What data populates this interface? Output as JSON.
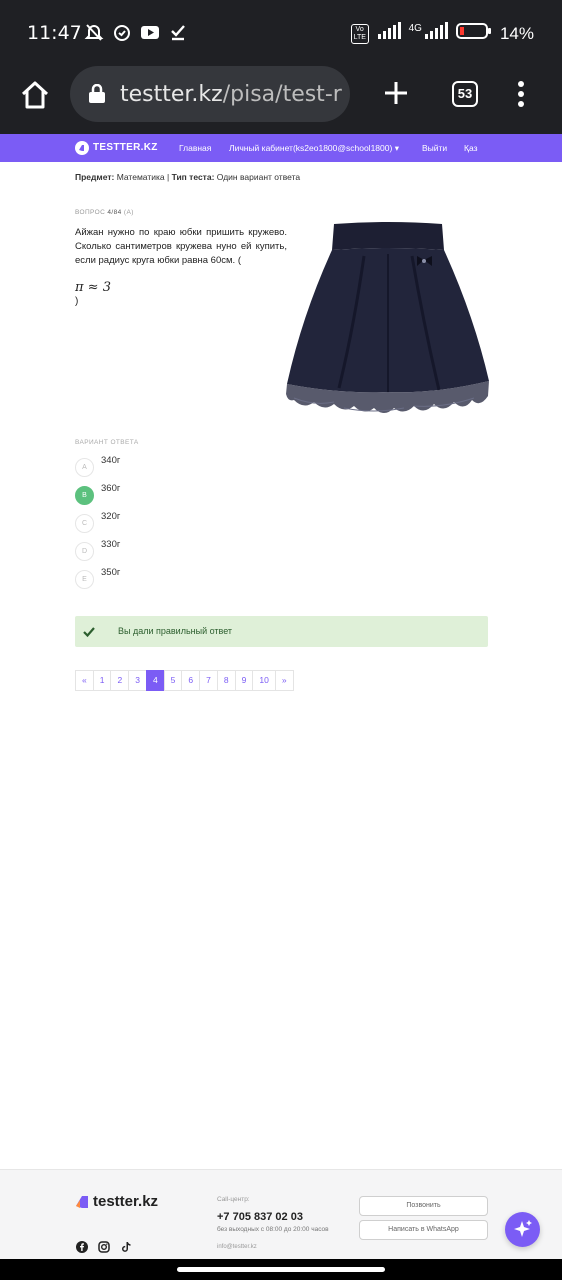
{
  "status_bar": {
    "time": "11:47",
    "network": "4G",
    "volte": "Vo LTE",
    "battery": "14%"
  },
  "browser": {
    "url_domain": "testter.kz",
    "url_path": "/pisa/test-re",
    "tab_count": "53"
  },
  "site_nav": {
    "brand": "TESTTER.KZ",
    "links": [
      "Главная",
      "Личный кабинет(ks2eo1800@school1800)",
      "Выйти",
      "Қаз"
    ],
    "dropdown_caret": "▾"
  },
  "meta": {
    "subject_label": "Предмет:",
    "subject_value": "Математика",
    "separator": "|",
    "type_label": "Тип теста:",
    "type_value": "Один вариант ответа"
  },
  "question": {
    "label_prefix": "ВОПРОС",
    "number": "4/84",
    "code": "(A)",
    "text": "Айжан нужно по краю юбки пришить кружево. Сколько сантиметров кружева нуно ей купить, если радиус круга юбки равна 60см. (",
    "formula": "π ≈ 3",
    "close_paren": ")"
  },
  "answers": {
    "label": "ВАРИАНТ ОТВЕТА",
    "options": [
      {
        "letter": "A",
        "text": "340г",
        "correct": false
      },
      {
        "letter": "B",
        "text": "360г",
        "correct": true
      },
      {
        "letter": "C",
        "text": "320г",
        "correct": false
      },
      {
        "letter": "D",
        "text": "330г",
        "correct": false
      },
      {
        "letter": "E",
        "text": "350г",
        "correct": false
      }
    ]
  },
  "feedback": {
    "message": "Вы дали правильный ответ",
    "color": "#dff0d8"
  },
  "pagination": {
    "prev": "«",
    "next": "»",
    "pages": [
      "1",
      "2",
      "3",
      "4",
      "5",
      "6",
      "7",
      "8",
      "9",
      "10"
    ],
    "current": "4"
  },
  "footer": {
    "brand": "testter.kz",
    "call_center_label": "Call-центр:",
    "phone": "+7 705 837 02 03",
    "hours": "без выходных с 08:00 до 20:00 часов",
    "email": "info@testter.kz",
    "call_button": "Позвонить",
    "whatsapp_button": "Написать в WhatsApp"
  },
  "colors": {
    "accent": "#7b5cf5",
    "correct": "#5cc17e",
    "dark_bar": "#1f2024"
  }
}
